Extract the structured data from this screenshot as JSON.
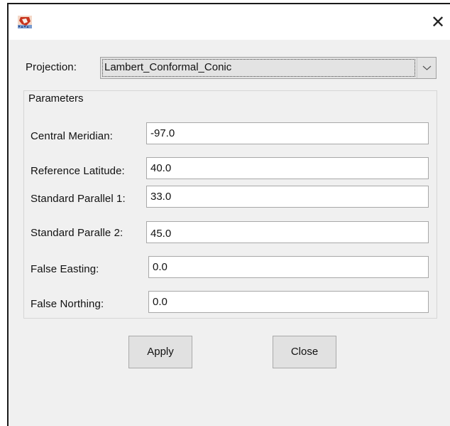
{
  "window": {
    "close_glyph": "✕"
  },
  "projection": {
    "label": "Projection:",
    "selected": "Lambert_Conformal_Conic"
  },
  "parameters": {
    "title": "Parameters",
    "fields": [
      {
        "label": "Central Meridian:",
        "value": "-97.0"
      },
      {
        "label": "Reference Latitude:",
        "value": "40.0"
      },
      {
        "label": "Standard Parallel 1:",
        "value": "33.0"
      },
      {
        "label": "Standard Paralle 2:",
        "value": "45.0"
      },
      {
        "label": "False Easting:",
        "value": "0.0"
      },
      {
        "label": "False Northing:",
        "value": "0.0"
      }
    ]
  },
  "buttons": {
    "apply": "Apply",
    "close": "Close"
  },
  "icons": {
    "app": "map-app-icon",
    "close": "close-icon",
    "dropdown": "chevron-down-icon"
  }
}
